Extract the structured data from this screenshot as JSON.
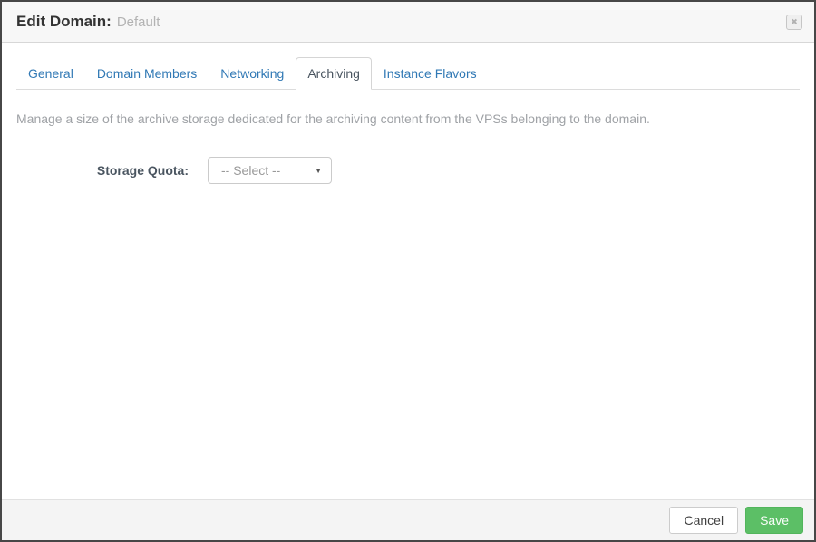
{
  "header": {
    "title": "Edit Domain:",
    "domain_name": "Default"
  },
  "icons": {
    "close": "✖",
    "dropdown_arrow": "▼"
  },
  "tabs": {
    "active": "Archiving",
    "items": [
      {
        "label": "General"
      },
      {
        "label": "Domain Members"
      },
      {
        "label": "Networking"
      },
      {
        "label": "Archiving"
      },
      {
        "label": "Instance Flavors"
      }
    ]
  },
  "content": {
    "description": "Manage a size of the archive storage dedicated for the archiving content from the VPSs belonging to the domain.",
    "storage_quota": {
      "label": "Storage Quota:",
      "selected_value": "-- Select --"
    }
  },
  "footer": {
    "cancel_label": "Cancel",
    "save_label": "Save"
  },
  "colors": {
    "tab_link": "#3179b5",
    "active_tab_text": "#4a5560",
    "save_green": "#5cbf66",
    "header_bg": "#f7f7f7",
    "footer_bg": "#f4f4f4"
  }
}
